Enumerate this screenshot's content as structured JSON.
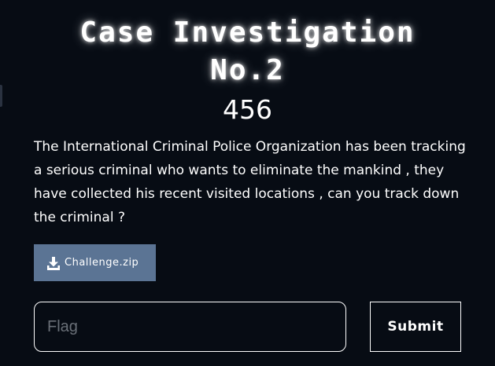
{
  "challenge": {
    "title_line1": "Case Investigation",
    "title_line2": "No.2",
    "points": "456",
    "description": "The International Criminal Police Organization has been tracking a serious criminal who wants to eliminate the mankind , they have collected his recent visited locations , can you track down the criminal ?",
    "attachment": {
      "label": "Challenge.zip",
      "icon": "download-icon"
    }
  },
  "flag_form": {
    "placeholder": "Flag",
    "value": "",
    "submit_label": "Submit"
  },
  "colors": {
    "background": "#070c14",
    "attachment_button": "#5b7494",
    "text": "#ffffff",
    "placeholder": "#6a7078"
  }
}
